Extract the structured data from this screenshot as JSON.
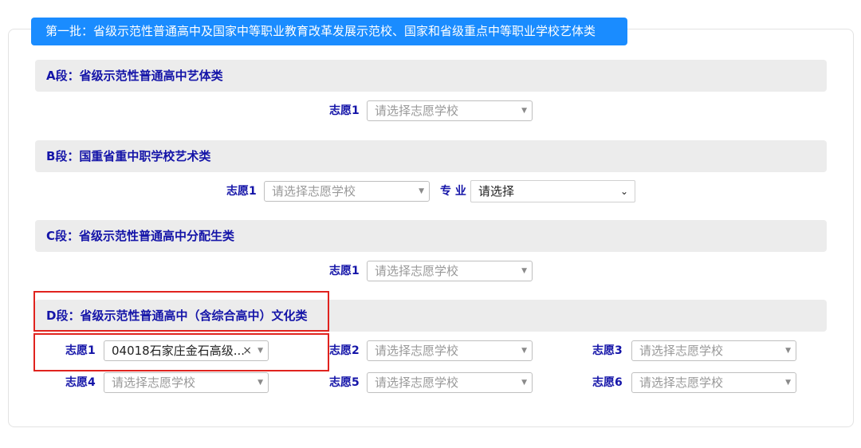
{
  "batch_title": "第一批：省级示范性普通高中及国家中等职业教育改革发展示范校、国家和省级重点中等职业学校艺体类",
  "sections": {
    "a": {
      "header": "A段：省级示范性普通高中艺体类",
      "choice1_label": "志愿1",
      "choice1_placeholder": "请选择志愿学校"
    },
    "b": {
      "header": "B段：国重省重中职学校艺术类",
      "choice1_label": "志愿1",
      "choice1_placeholder": "请选择志愿学校",
      "major_label": "专 业",
      "major_value": "请选择"
    },
    "c": {
      "header": "C段：省级示范性普通高中分配生类",
      "choice1_label": "志愿1",
      "choice1_placeholder": "请选择志愿学校"
    },
    "d": {
      "header": "D段：省级示范性普通高中（含综合高中）文化类",
      "choices": [
        {
          "label": "志愿1",
          "value": "04018石家庄金石高级..."
        },
        {
          "label": "志愿2",
          "placeholder": "请选择志愿学校"
        },
        {
          "label": "志愿3",
          "placeholder": "请选择志愿学校"
        },
        {
          "label": "志愿4",
          "placeholder": "请选择志愿学校"
        },
        {
          "label": "志愿5",
          "placeholder": "请选择志愿学校"
        },
        {
          "label": "志愿6",
          "placeholder": "请选择志愿学校"
        }
      ]
    }
  },
  "icons": {
    "caret": "caret-down-icon",
    "clear": "clear-x-icon",
    "chevron": "chevron-down-icon"
  },
  "colors": {
    "accent": "#1a8cff",
    "label": "#1414a8",
    "highlight": "#e0231e"
  }
}
